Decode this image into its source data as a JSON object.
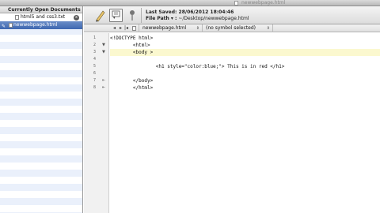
{
  "window": {
    "title": "newwebpage.html"
  },
  "sidebar": {
    "header": "Currently Open Documents",
    "documents": [
      {
        "name": "html5 and css3.txt",
        "close": "x"
      },
      {
        "name": "newwebpage.html",
        "mark": "✎"
      }
    ]
  },
  "toolbar": {
    "last_saved": "Last Saved: 28/06/2012 18:04:46",
    "file_path_label": "File Path ▾ :",
    "file_path_value": "~/Desktop/newwebpage.html",
    "palette_dropdown": "▾"
  },
  "navbar": {
    "back": "◂",
    "forward": "▸",
    "prev_doc": "|◂",
    "next_doc": "▸|",
    "file": "newwebpage.html",
    "symbol": "(no symbol selected)",
    "updown": "⇕"
  },
  "editor": {
    "line_numbers": [
      "1",
      "2",
      "3",
      "4",
      "5",
      "6",
      "7",
      "8"
    ],
    "lines": [
      "<!DOCTYPE html>",
      "        <html>",
      "        <body >",
      "",
      "                <h1 style=\"color:blue;\"> This is in red </h1>",
      "",
      "        </body>",
      "        </html>"
    ],
    "folds": [
      "",
      "▼",
      "▼",
      "",
      "",
      "",
      "⇤",
      "⇤"
    ],
    "highlight_line": 3
  }
}
